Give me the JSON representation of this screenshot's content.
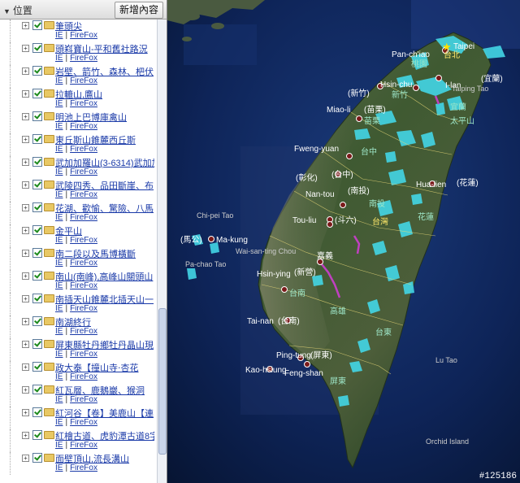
{
  "panel": {
    "title": "位置",
    "add_button": "新增內容"
  },
  "tree": {
    "link_ie": "IE",
    "link_firefox": "FireFox",
    "items": [
      {
        "title": "筆頭尖"
      },
      {
        "title": "頭嵙寶山-平和舊社路況"
      },
      {
        "title": "岩壁、箭竹、森林、杷伏"
      },
      {
        "title": "拉轆山,鷹山"
      },
      {
        "title": "明池上巴博庫禽山"
      },
      {
        "title": "東丘斯山錐麓西丘斯"
      },
      {
        "title": "武加加羅山(3-6314)武加加"
      },
      {
        "title": "武陵四秀、品田斷崖、布"
      },
      {
        "title": "花湖、歡愉、驚險、八馬"
      },
      {
        "title": "金平山"
      },
      {
        "title": "南二段以及馬博橫斷"
      },
      {
        "title": "南山(南峰),高峰山關頭山"
      },
      {
        "title": "南插天山錐麓北插天山一"
      },
      {
        "title": "南湖終行"
      },
      {
        "title": "屏東縣牡丹鄉牡丹晶山現"
      },
      {
        "title": "政大泰【撞山寺‧杏花"
      },
      {
        "title": "紅瓦層、鹿鵝巖、猴洞"
      },
      {
        "title": "紅河谷【卷】美鹿山【連"
      },
      {
        "title": "紅檜古道、虎豹潭古道8字"
      },
      {
        "title": "面壁頂山,流長溝山"
      }
    ]
  },
  "map": {
    "labels": {
      "pan_chiao": "Pan-ch'iao",
      "taipei": "Taipei",
      "taibei": "台北",
      "taoyuan": "桃園",
      "hsinchu": "Hsin-chu",
      "hsinchu_paren": "(新竹)",
      "xinzhu": "新竹",
      "ilan": "I-lan",
      "ilan_paren": "(宜蘭)",
      "yilan": "宜蘭",
      "miaoli": "Miao-li",
      "miaoli_paren": "(苗栗)",
      "miaoli_cn": "苗栗",
      "fwengyuan": "Fweng-yuan",
      "taichung": "台中",
      "changhua": "(彰化)",
      "taichung_paren": "(台中)",
      "nantou": "Nan-tou",
      "nantou_paren": "(南投)",
      "nantou_cn": "南投",
      "hualien": "Hua-lien",
      "hualien_paren": "(花蓮)",
      "touliu": "Tou-liu",
      "douliu": "(斗六)",
      "taiwan": "台灣",
      "hualien_cn": "花蓮",
      "chiayi": "嘉義",
      "chiayi_paren": "(嘉義)",
      "hsinying": "Hsin-ying",
      "xinying": "(新營)",
      "tainan_cn": "台南",
      "kaohsiung_cn": "高雄",
      "tainan": "Tai-nan",
      "tainan_paren": "(台南)",
      "taitung": "台東",
      "pingtung": "Ping-tung",
      "pingtung_paren": "(屏東)",
      "kaohsiung": "Kao-hsiung",
      "fengshan": "Feng-shan",
      "pingtung_cn": "屏東",
      "chipeitao": "Chi-pei Tao",
      "makung": "Ma-kung",
      "makung_paren": "(馬公)",
      "pachaotao": "Pa-chao Tao",
      "waisanding": "Wai-san-ting Chou",
      "lutao": "Lu Tao",
      "orchid": "Orchid Island",
      "taiping": "Taiping Tao",
      "taiping_cn": "太平山"
    }
  },
  "badge": "#125186"
}
